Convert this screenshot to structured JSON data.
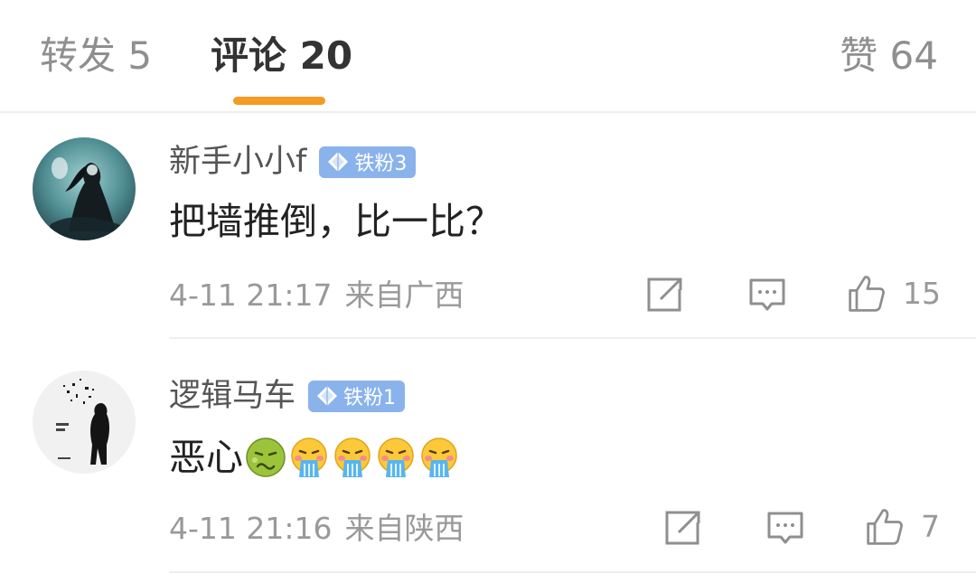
{
  "tabs": {
    "repost": "转发 5",
    "comments": "评论 20",
    "likes": "赞 64"
  },
  "colors": {
    "accent": "#f59b23",
    "badge": "#8ab3ec",
    "muted_text": "#999999"
  },
  "comments": [
    {
      "username": "新手小小f",
      "badge": "铁粉3",
      "text": "把墙推倒，比一比？",
      "emojis": [],
      "time": "4-11 21:17",
      "location": "来自广西",
      "likes": "15",
      "icons": [
        "share-icon",
        "reply-icon",
        "like-icon"
      ]
    },
    {
      "username": "逻辑马车",
      "badge": "铁粉1",
      "text": "恶心",
      "emojis": [
        "nauseated-face-emoji",
        "vomiting-face-emoji",
        "vomiting-face-emoji",
        "vomiting-face-emoji",
        "vomiting-face-emoji"
      ],
      "time": "4-11 21:16",
      "location": "来自陕西",
      "likes": "7",
      "icons": [
        "share-icon",
        "reply-icon",
        "like-icon"
      ]
    }
  ]
}
